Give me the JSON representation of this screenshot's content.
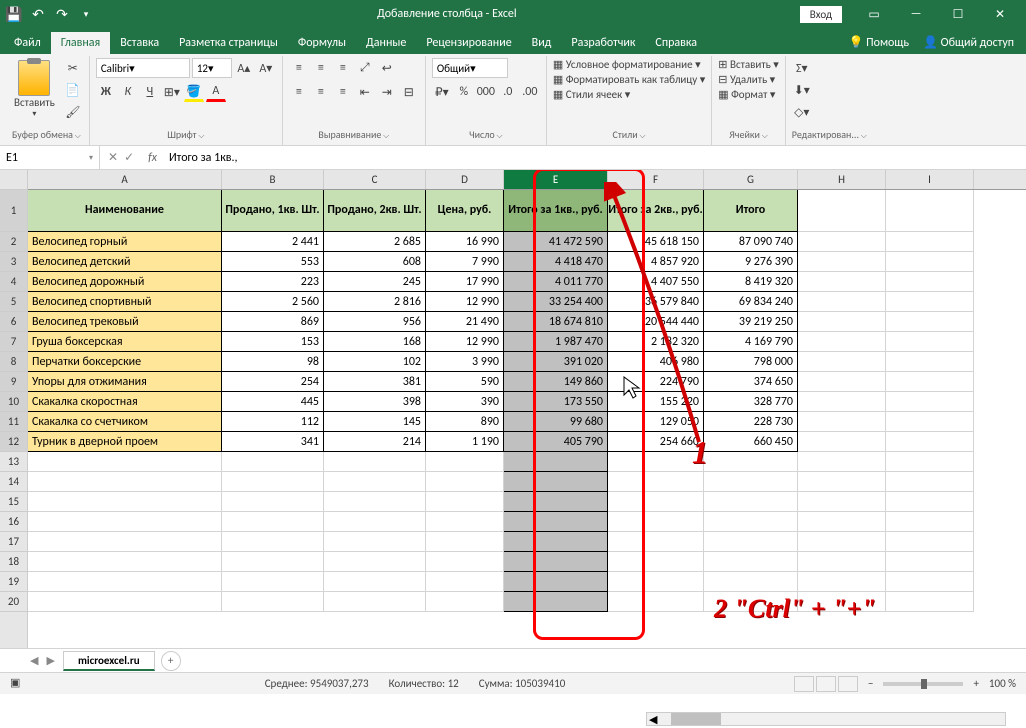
{
  "title": "Добавление столбца - Excel",
  "login": "Вход",
  "menu": {
    "file": "Файл",
    "home": "Главная",
    "insert": "Вставка",
    "layout": "Разметка страницы",
    "formulas": "Формулы",
    "data": "Данные",
    "review": "Рецензирование",
    "view": "Вид",
    "dev": "Разработчик",
    "help": "Справка",
    "tell": "Помощь",
    "share": "Общий доступ"
  },
  "ribbon": {
    "paste": "Вставить",
    "clipboard": "Буфер обмена",
    "font_group": "Шрифт",
    "font": "Calibri",
    "size": "12",
    "align": "Выравнивание",
    "number_group": "Число",
    "number_fmt": "Общий",
    "styles": "Стили",
    "cond_fmt": "Условное форматирование",
    "tbl_fmt": "Форматировать как таблицу",
    "cell_styles": "Стили ячеек",
    "cells": "Ячейки",
    "insert_btn": "Вставить",
    "delete_btn": "Удалить",
    "format_btn": "Формат",
    "editing": "Редактирован..."
  },
  "namebox": "E1",
  "formula": "Итого за 1кв.,",
  "cols": [
    "A",
    "B",
    "C",
    "D",
    "E",
    "F",
    "G",
    "H",
    "I"
  ],
  "headers": [
    "Наименование",
    "Продано, 1кв. Шт.",
    "Продано, 2кв. Шт.",
    "Цена, руб.",
    "Итого за 1кв., руб.",
    "Итого за 2кв., руб.",
    "Итого"
  ],
  "rows": [
    {
      "n": "Велосипед горный",
      "b": "2 441",
      "c": "2 685",
      "d": "16 990",
      "e": "41 472 590",
      "f": "45 618 150",
      "g": "87 090 740"
    },
    {
      "n": "Велосипед детский",
      "b": "553",
      "c": "608",
      "d": "7 990",
      "e": "4 418 470",
      "f": "4 857 920",
      "g": "9 276 390"
    },
    {
      "n": "Велосипед дорожный",
      "b": "223",
      "c": "245",
      "d": "17 990",
      "e": "4 011 770",
      "f": "4 407 550",
      "g": "8 419 320"
    },
    {
      "n": "Велосипед спортивный",
      "b": "2 560",
      "c": "2 816",
      "d": "12 990",
      "e": "33 254 400",
      "f": "36 579 840",
      "g": "69 834 240"
    },
    {
      "n": "Велосипед трековый",
      "b": "869",
      "c": "956",
      "d": "21 490",
      "e": "18 674 810",
      "f": "20 544 440",
      "g": "39 219 250"
    },
    {
      "n": "Груша боксерская",
      "b": "153",
      "c": "168",
      "d": "12 990",
      "e": "1 987 470",
      "f": "2 182 320",
      "g": "4 169 790"
    },
    {
      "n": "Перчатки боксерские",
      "b": "98",
      "c": "102",
      "d": "3 990",
      "e": "391 020",
      "f": "406 980",
      "g": "798 000"
    },
    {
      "n": "Упоры для отжимания",
      "b": "254",
      "c": "381",
      "d": "590",
      "e": "149 860",
      "f": "224 790",
      "g": "374 650"
    },
    {
      "n": "Скакалка скоростная",
      "b": "445",
      "c": "398",
      "d": "390",
      "e": "173 550",
      "f": "155 220",
      "g": "328 770"
    },
    {
      "n": "Скакалка со счетчиком",
      "b": "112",
      "c": "145",
      "d": "890",
      "e": "99 680",
      "f": "129 050",
      "g": "228 730"
    },
    {
      "n": "Турник в дверной проем",
      "b": "341",
      "c": "214",
      "d": "1 190",
      "e": "405 790",
      "f": "254 660",
      "g": "660 450"
    }
  ],
  "sheet": "microexcel.ru",
  "status": {
    "avg": "Среднее: 9549037,273",
    "count": "Количество: 12",
    "sum": "Сумма: 105039410",
    "zoom": "100 %"
  },
  "anno": {
    "a1": "1",
    "a2": "2 \"Ctrl\" + \"+\""
  }
}
